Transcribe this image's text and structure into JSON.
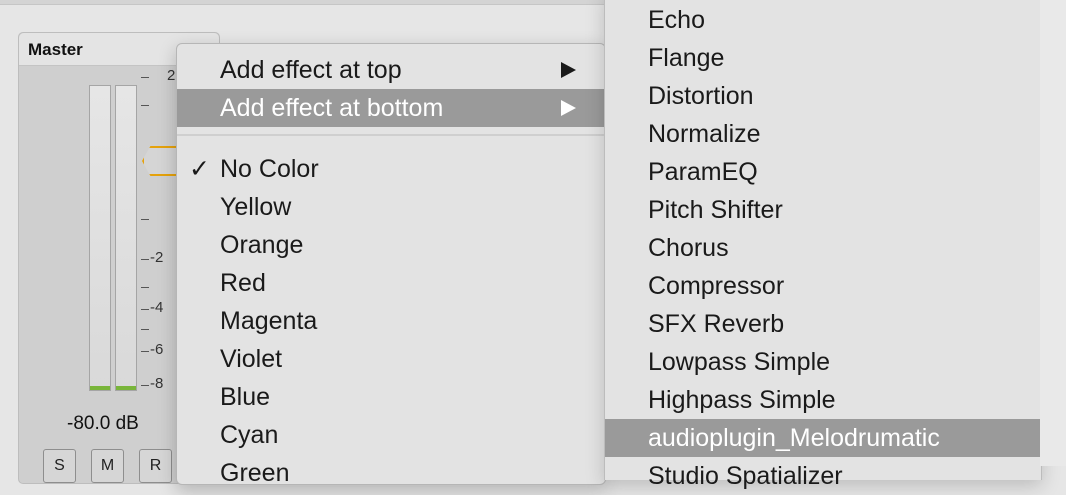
{
  "strip": {
    "title": "Master",
    "scale_labels": [
      "2",
      "-2",
      "-4",
      "-6",
      "-8"
    ],
    "db_readout": "-80.0 dB",
    "buttons": [
      "S",
      "M",
      "R"
    ],
    "meter_level_fraction": 0.01,
    "accent_color": "#e5a20c",
    "meter_color": "#79b53a"
  },
  "context_menu": {
    "items": [
      {
        "label": "Add effect at top",
        "submenu": true
      },
      {
        "label": "Add effect at bottom",
        "submenu": true,
        "highlighted": true
      }
    ],
    "colors": [
      {
        "label": "No Color",
        "checked": true
      },
      {
        "label": "Yellow"
      },
      {
        "label": "Orange"
      },
      {
        "label": "Red"
      },
      {
        "label": "Magenta"
      },
      {
        "label": "Violet"
      },
      {
        "label": "Blue"
      },
      {
        "label": "Cyan"
      },
      {
        "label": "Green"
      }
    ],
    "check_glyph": "✓",
    "highlight_color": "#9a9a9a"
  },
  "effects_submenu": {
    "items": [
      "Echo",
      "Flange",
      "Distortion",
      "Normalize",
      "ParamEQ",
      "Pitch Shifter",
      "Chorus",
      "Compressor",
      "SFX Reverb",
      "Lowpass Simple",
      "Highpass Simple",
      "audioplugin_Melodrumatic",
      "Studio Spatializer"
    ],
    "highlighted_index": 11
  }
}
